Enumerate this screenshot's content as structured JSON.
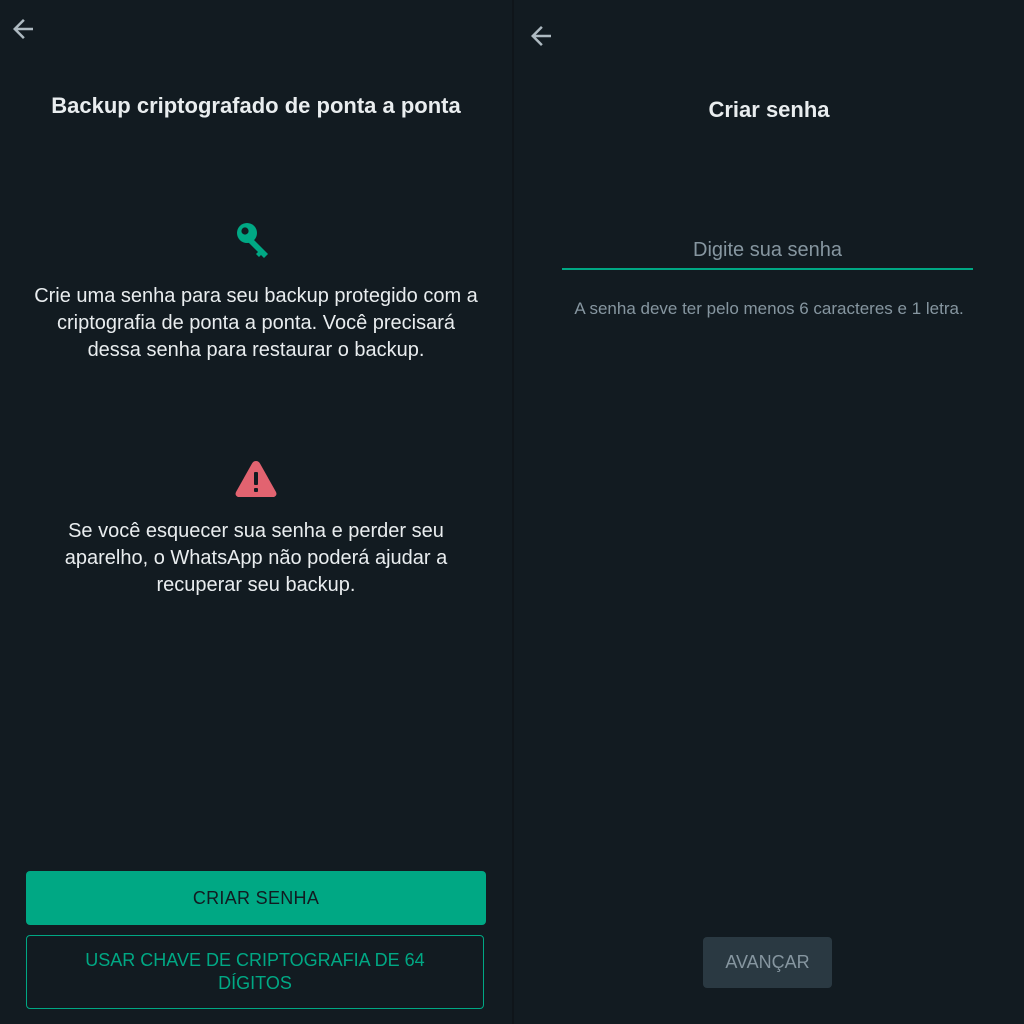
{
  "colors": {
    "background": "#121b21",
    "accent": "#00a884",
    "text_primary": "#e9edef",
    "text_secondary": "#8696a0",
    "warning": "#e26370",
    "disabled_button": "#2a3942"
  },
  "left_screen": {
    "back_icon": "arrow-back-icon",
    "title": "Backup criptografado de ponta a ponta",
    "key_icon": "key-icon",
    "intro_text": "Crie uma senha para seu backup protegido com a criptografia de ponta a ponta. Você precisará dessa senha para restaurar o backup.",
    "warning_icon": "warning-triangle-icon",
    "warning_text": "Se você esquecer sua senha e perder seu aparelho, o WhatsApp não poderá ajudar a recuperar seu backup.",
    "create_password_button": "CRIAR SENHA",
    "use_key_button": "USAR CHAVE DE CRIPTOGRAFIA DE 64 DÍGITOS"
  },
  "right_screen": {
    "back_icon": "arrow-back-icon",
    "title": "Criar senha",
    "password_input": {
      "placeholder": "Digite sua senha",
      "value": ""
    },
    "hint": "A senha deve ter pelo menos 6 caracteres e 1 letra.",
    "next_button": "AVANÇAR"
  }
}
